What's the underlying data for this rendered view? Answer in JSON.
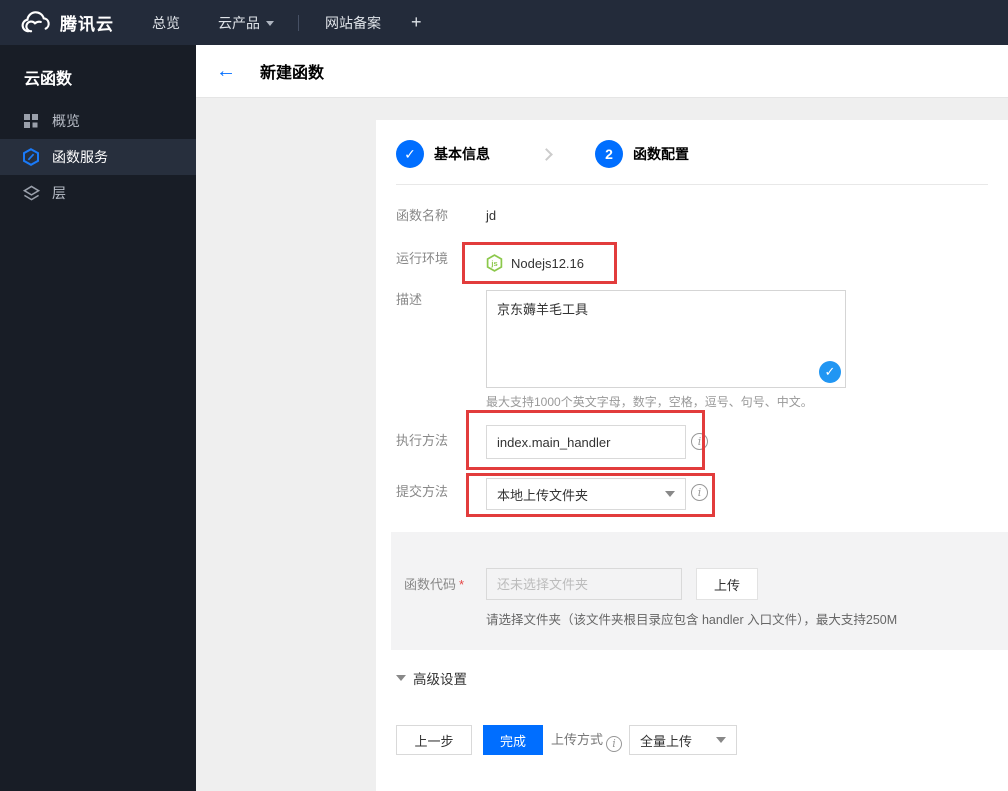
{
  "colors": {
    "accent_blue": "#006eff",
    "annotation_red": "#e23c3c",
    "node_green": "#8cc84b",
    "valid_badge_blue": "#2196f3",
    "navbar_bg": "#232b3a",
    "sidebar_bg": "#181d26"
  },
  "topnav": {
    "brand": "腾讯云",
    "overview": "总览",
    "products": "云产品",
    "icp": "网站备案",
    "plus": "+"
  },
  "sidebar": {
    "title": "云函数",
    "items": [
      {
        "label": "概览",
        "icon": "grid-icon",
        "active": false
      },
      {
        "label": "函数服务",
        "icon": "function-hexagon-icon",
        "active": true
      },
      {
        "label": "层",
        "icon": "layers-icon",
        "active": false
      }
    ]
  },
  "header": {
    "title": "新建函数"
  },
  "steps": {
    "step1_label": "基本信息",
    "step2_number": "2",
    "step2_label": "函数配置"
  },
  "form": {
    "name_label": "函数名称",
    "name_value": "jd",
    "runtime_label": "运行环境",
    "runtime_value": "Nodejs12.16",
    "desc_label": "描述",
    "desc_value": "京东薅羊毛工具",
    "desc_hint": "最大支持1000个英文字母，数字，空格，逗号、句号、中文。",
    "handler_label": "执行方法",
    "handler_value": "index.main_handler",
    "submit_label": "提交方法",
    "submit_value": "本地上传文件夹",
    "code_label": "函数代码",
    "code_required": "*",
    "code_placeholder": "还未选择文件夹",
    "upload_button": "上传",
    "code_hint": "请选择文件夹（该文件夹根目录应包含 handler 入口文件），最大支持250M"
  },
  "advanced": {
    "label": "高级设置"
  },
  "footer": {
    "prev": "上一步",
    "finish": "完成",
    "upload_mode_label": "上传方式",
    "upload_mode_value": "全量上传"
  }
}
